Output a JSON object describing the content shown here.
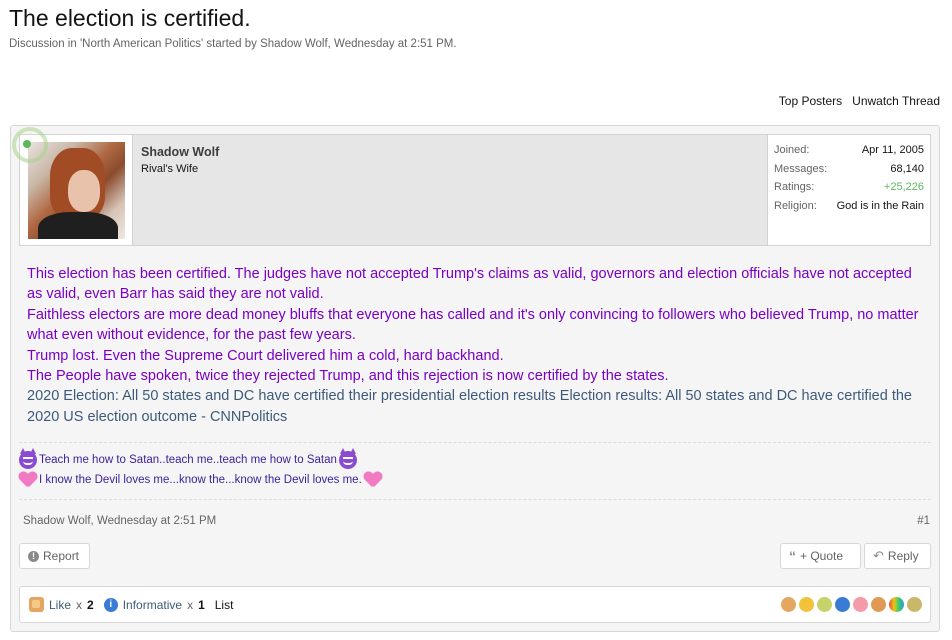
{
  "thread": {
    "title": "The election is certified.",
    "desc_prefix": "Discussion in ",
    "forum": "'North American Politics'",
    "desc_mid": " started by ",
    "starter": "Shadow Wolf",
    "desc_sep": ", ",
    "started": "Wednesday at 2:51 PM",
    "desc_end": "."
  },
  "thread_links": {
    "top_posters": "Top Posters",
    "unwatch": "Unwatch Thread"
  },
  "user": {
    "name": "Shadow Wolf",
    "title": "Rival's Wife",
    "stats": [
      {
        "label": "Joined:",
        "value": "Apr 11, 2005"
      },
      {
        "label": "Messages:",
        "value": "68,140"
      },
      {
        "label": "Ratings:",
        "value": "+25,226"
      },
      {
        "label": "Religion:",
        "value": "God is in the Rain"
      }
    ]
  },
  "message": {
    "line1": "This election has been certified. The judges have not accepted Trump's claims as valid, governors and election officials have not accepted as valid, even Barr has said they are not valid.",
    "line2": "Faithless electors are more dead money bluffs that everyone has called and it's only convincing to followers who believed Trump, no matter what even without evidence, for the past few years.",
    "line3": "Trump lost. Even the Supreme Court delivered him a cold, hard backhand.",
    "line4": "The People have spoken, twice they rejected Trump, and this rejection is now certified by the states.",
    "link": "2020 Election: All 50 states and DC have certified their presidential election results Election results: All 50 states and DC have certified the 2020 US election outcome - CNNPolitics"
  },
  "signature": {
    "line1": "Teach me how to Satan..teach me..teach me how to Satan",
    "line2": "I know the Devil loves me...know the...know the Devil loves me."
  },
  "post": {
    "author": "Shadow Wolf",
    "sep": ", ",
    "time": "Wednesday at 2:51 PM",
    "number": "#1",
    "report": "Report",
    "quote": "+ Quote",
    "reply": "Reply"
  },
  "ratings": {
    "like_label": "Like",
    "like_x": "x",
    "like_count": "2",
    "info_label": "Informative",
    "info_x": "x",
    "info_count": "1",
    "list": "List"
  },
  "colors": {
    "message": "#7a00c2",
    "link": "#3d5a7a",
    "positive": "#5cb85c",
    "signature": "#3a1f9a"
  },
  "icons": [
    "like-icon",
    "info-icon",
    "report-icon",
    "quote-icon",
    "reply-icon",
    "devil-emoji-icon",
    "heart-emoji-icon"
  ]
}
